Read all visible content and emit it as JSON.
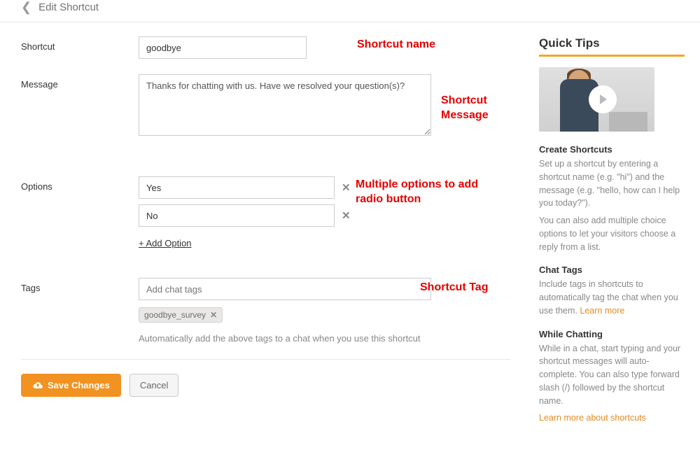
{
  "header": {
    "title": "Edit Shortcut"
  },
  "form": {
    "shortcut_label": "Shortcut",
    "shortcut_value": "goodbye",
    "message_label": "Message",
    "message_value": "Thanks for chatting with us. Have we resolved your question(s)?",
    "options_label": "Options",
    "options": [
      "Yes",
      "No"
    ],
    "add_option_label": "+ Add Option",
    "tags_label": "Tags",
    "tags_placeholder": "Add chat tags",
    "tag_chips": [
      "goodbye_survey"
    ],
    "tags_help": "Automatically add the above tags to a chat when you use this shortcut"
  },
  "buttons": {
    "save": "Save Changes",
    "cancel": "Cancel"
  },
  "annotations": {
    "shortcut_name": "Shortcut name",
    "shortcut_message": "Shortcut\nMessage",
    "options_multi": "Multiple options to add\nradio button",
    "shortcut_tag": "Shortcut Tag"
  },
  "tips": {
    "title": "Quick Tips",
    "sections": [
      {
        "heading": "Create Shortcuts",
        "body": [
          "Set up a shortcut by entering a shortcut name (e.g. \"hi\") and the message (e.g. \"hello, how can I help you today?\").",
          "You can also add multiple choice options to let your visitors choose a reply from a list."
        ]
      },
      {
        "heading": "Chat Tags",
        "body": [
          "Include tags in shortcuts to automatically tag the chat when you use them."
        ],
        "link": "Learn more"
      },
      {
        "heading": "While Chatting",
        "body": [
          "While in a chat, start typing and your shortcut messages will auto-complete. You can also type forward slash (/) followed by the shortcut name."
        ],
        "link_below": "Learn more about shortcuts"
      }
    ]
  }
}
